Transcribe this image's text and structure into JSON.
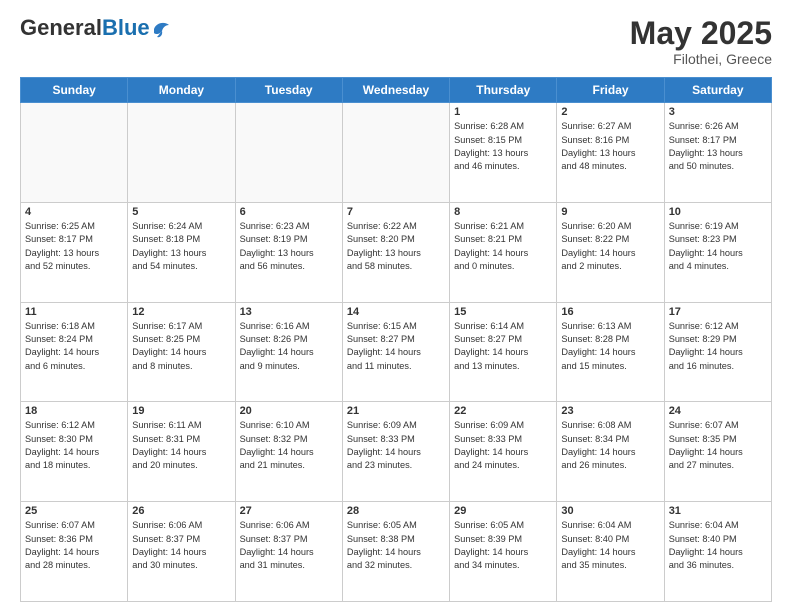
{
  "header": {
    "logo_general": "General",
    "logo_blue": "Blue",
    "title": "May 2025",
    "location": "Filothei, Greece"
  },
  "calendar": {
    "days_of_week": [
      "Sunday",
      "Monday",
      "Tuesday",
      "Wednesday",
      "Thursday",
      "Friday",
      "Saturday"
    ],
    "weeks": [
      [
        {
          "day": "",
          "info": ""
        },
        {
          "day": "",
          "info": ""
        },
        {
          "day": "",
          "info": ""
        },
        {
          "day": "",
          "info": ""
        },
        {
          "day": "1",
          "info": "Sunrise: 6:28 AM\nSunset: 8:15 PM\nDaylight: 13 hours\nand 46 minutes."
        },
        {
          "day": "2",
          "info": "Sunrise: 6:27 AM\nSunset: 8:16 PM\nDaylight: 13 hours\nand 48 minutes."
        },
        {
          "day": "3",
          "info": "Sunrise: 6:26 AM\nSunset: 8:17 PM\nDaylight: 13 hours\nand 50 minutes."
        }
      ],
      [
        {
          "day": "4",
          "info": "Sunrise: 6:25 AM\nSunset: 8:17 PM\nDaylight: 13 hours\nand 52 minutes."
        },
        {
          "day": "5",
          "info": "Sunrise: 6:24 AM\nSunset: 8:18 PM\nDaylight: 13 hours\nand 54 minutes."
        },
        {
          "day": "6",
          "info": "Sunrise: 6:23 AM\nSunset: 8:19 PM\nDaylight: 13 hours\nand 56 minutes."
        },
        {
          "day": "7",
          "info": "Sunrise: 6:22 AM\nSunset: 8:20 PM\nDaylight: 13 hours\nand 58 minutes."
        },
        {
          "day": "8",
          "info": "Sunrise: 6:21 AM\nSunset: 8:21 PM\nDaylight: 14 hours\nand 0 minutes."
        },
        {
          "day": "9",
          "info": "Sunrise: 6:20 AM\nSunset: 8:22 PM\nDaylight: 14 hours\nand 2 minutes."
        },
        {
          "day": "10",
          "info": "Sunrise: 6:19 AM\nSunset: 8:23 PM\nDaylight: 14 hours\nand 4 minutes."
        }
      ],
      [
        {
          "day": "11",
          "info": "Sunrise: 6:18 AM\nSunset: 8:24 PM\nDaylight: 14 hours\nand 6 minutes."
        },
        {
          "day": "12",
          "info": "Sunrise: 6:17 AM\nSunset: 8:25 PM\nDaylight: 14 hours\nand 8 minutes."
        },
        {
          "day": "13",
          "info": "Sunrise: 6:16 AM\nSunset: 8:26 PM\nDaylight: 14 hours\nand 9 minutes."
        },
        {
          "day": "14",
          "info": "Sunrise: 6:15 AM\nSunset: 8:27 PM\nDaylight: 14 hours\nand 11 minutes."
        },
        {
          "day": "15",
          "info": "Sunrise: 6:14 AM\nSunset: 8:27 PM\nDaylight: 14 hours\nand 13 minutes."
        },
        {
          "day": "16",
          "info": "Sunrise: 6:13 AM\nSunset: 8:28 PM\nDaylight: 14 hours\nand 15 minutes."
        },
        {
          "day": "17",
          "info": "Sunrise: 6:12 AM\nSunset: 8:29 PM\nDaylight: 14 hours\nand 16 minutes."
        }
      ],
      [
        {
          "day": "18",
          "info": "Sunrise: 6:12 AM\nSunset: 8:30 PM\nDaylight: 14 hours\nand 18 minutes."
        },
        {
          "day": "19",
          "info": "Sunrise: 6:11 AM\nSunset: 8:31 PM\nDaylight: 14 hours\nand 20 minutes."
        },
        {
          "day": "20",
          "info": "Sunrise: 6:10 AM\nSunset: 8:32 PM\nDaylight: 14 hours\nand 21 minutes."
        },
        {
          "day": "21",
          "info": "Sunrise: 6:09 AM\nSunset: 8:33 PM\nDaylight: 14 hours\nand 23 minutes."
        },
        {
          "day": "22",
          "info": "Sunrise: 6:09 AM\nSunset: 8:33 PM\nDaylight: 14 hours\nand 24 minutes."
        },
        {
          "day": "23",
          "info": "Sunrise: 6:08 AM\nSunset: 8:34 PM\nDaylight: 14 hours\nand 26 minutes."
        },
        {
          "day": "24",
          "info": "Sunrise: 6:07 AM\nSunset: 8:35 PM\nDaylight: 14 hours\nand 27 minutes."
        }
      ],
      [
        {
          "day": "25",
          "info": "Sunrise: 6:07 AM\nSunset: 8:36 PM\nDaylight: 14 hours\nand 28 minutes."
        },
        {
          "day": "26",
          "info": "Sunrise: 6:06 AM\nSunset: 8:37 PM\nDaylight: 14 hours\nand 30 minutes."
        },
        {
          "day": "27",
          "info": "Sunrise: 6:06 AM\nSunset: 8:37 PM\nDaylight: 14 hours\nand 31 minutes."
        },
        {
          "day": "28",
          "info": "Sunrise: 6:05 AM\nSunset: 8:38 PM\nDaylight: 14 hours\nand 32 minutes."
        },
        {
          "day": "29",
          "info": "Sunrise: 6:05 AM\nSunset: 8:39 PM\nDaylight: 14 hours\nand 34 minutes."
        },
        {
          "day": "30",
          "info": "Sunrise: 6:04 AM\nSunset: 8:40 PM\nDaylight: 14 hours\nand 35 minutes."
        },
        {
          "day": "31",
          "info": "Sunrise: 6:04 AM\nSunset: 8:40 PM\nDaylight: 14 hours\nand 36 minutes."
        }
      ]
    ]
  }
}
